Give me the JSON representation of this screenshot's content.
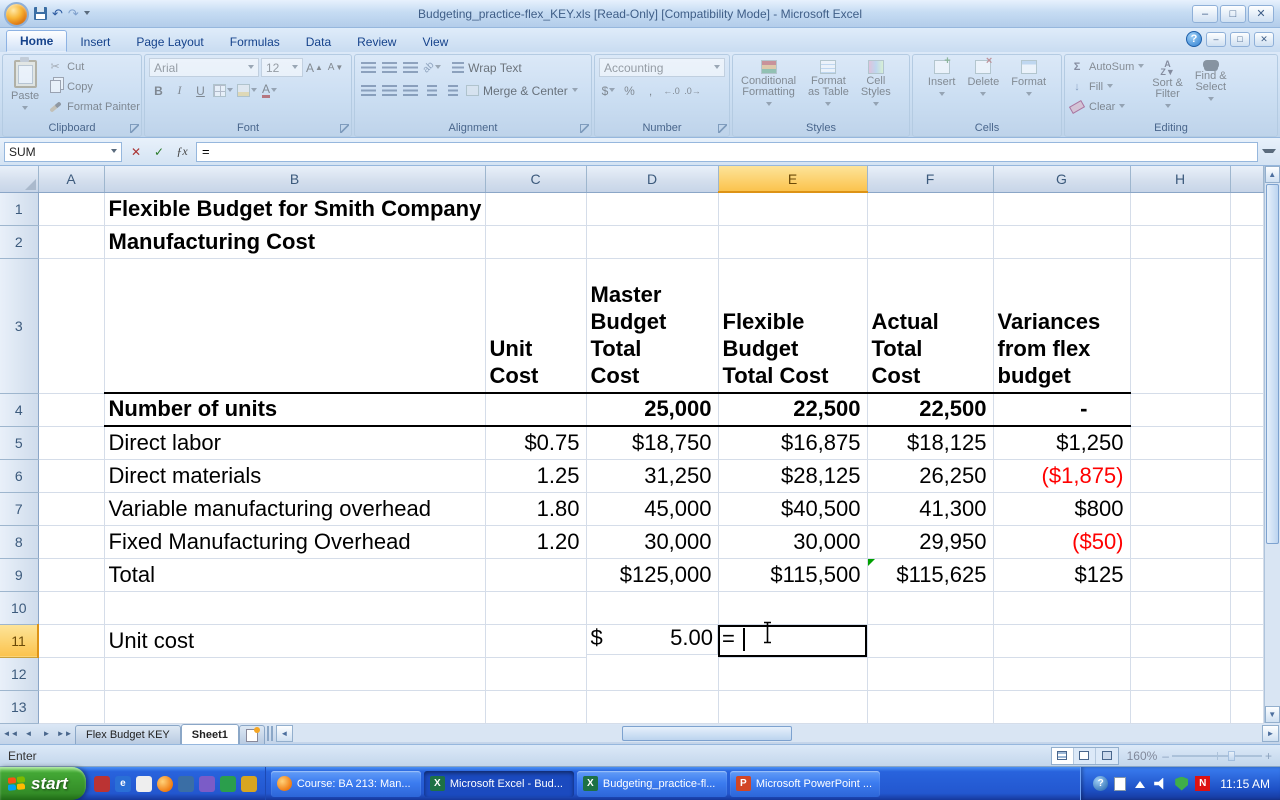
{
  "window": {
    "title": "Budgeting_practice-flex_KEY.xls  [Read-Only]  [Compatibility Mode] - Microsoft Excel"
  },
  "icons": {
    "undo": "↶",
    "redo": "↷",
    "scissors": "✂",
    "cancel": "✕",
    "check": "✓",
    "fx": "ƒx",
    "sigma": "Σ",
    "bold": "B",
    "italic": "I",
    "underline": "U",
    "font_color": "A",
    "grow_font": "A",
    "shrink_font": "A",
    "dollar": "$",
    "percent": "%",
    "comma": ",",
    "inc_decimal": "←.0",
    "dec_decimal": ".0→",
    "help": "?",
    "minimize": "–",
    "maximize": "□",
    "close": "✕",
    "az_sort": "A↓Z",
    "norton_n": "N",
    "question": "?"
  },
  "ribbon": {
    "tabs": [
      "Home",
      "Insert",
      "Page Layout",
      "Formulas",
      "Data",
      "Review",
      "View"
    ],
    "active_tab": "Home",
    "clipboard": {
      "title": "Clipboard",
      "paste": "Paste",
      "cut": "Cut",
      "copy": "Copy",
      "format_painter": "Format Painter"
    },
    "font": {
      "title": "Font",
      "font_name": "Arial",
      "font_size": "12"
    },
    "alignment": {
      "title": "Alignment",
      "wrap_text": "Wrap Text",
      "merge_center": "Merge & Center"
    },
    "number": {
      "title": "Number",
      "format": "Accounting"
    },
    "styles": {
      "title": "Styles",
      "conditional_formatting_1": "Conditional",
      "conditional_formatting_2": "Formatting",
      "format_as_table_1": "Format",
      "format_as_table_2": "as Table",
      "cell_styles_1": "Cell",
      "cell_styles_2": "Styles"
    },
    "cells": {
      "title": "Cells",
      "insert": "Insert",
      "delete": "Delete",
      "format": "Format"
    },
    "editing": {
      "title": "Editing",
      "autosum": "AutoSum",
      "fill": "Fill",
      "clear": "Clear",
      "sort_filter_1": "Sort &",
      "sort_filter_2": "Filter",
      "find_select_1": "Find &",
      "find_select_2": "Select"
    }
  },
  "formula_bar": {
    "name_box": "SUM",
    "formula": "="
  },
  "grid": {
    "columns": [
      "A",
      "B",
      "C",
      "D",
      "E",
      "F",
      "G",
      "H"
    ],
    "rows": [
      "1",
      "2",
      "3",
      "4",
      "5",
      "6",
      "7",
      "8",
      "9",
      "10",
      "11",
      "12",
      "13"
    ],
    "active_cell": "E11",
    "selected_column": "E",
    "selected_row": "11"
  },
  "sheet": {
    "title_line1": "Flexible Budget for Smith Company",
    "title_line2": "Manufacturing Cost",
    "col_headers": {
      "c": [
        "Unit",
        "Cost"
      ],
      "d": [
        "Master",
        "Budget",
        "Total",
        "Cost"
      ],
      "e": [
        "Flexible",
        "Budget",
        "Total Cost"
      ],
      "f": [
        "Actual",
        "Total",
        "Cost"
      ],
      "g": [
        "Variances",
        "from flex",
        "budget"
      ]
    },
    "rows": {
      "r4": {
        "label": "Number of units",
        "d": "25,000",
        "e": "22,500",
        "f": "22,500",
        "g": "-"
      },
      "r5": {
        "label": "Direct labor",
        "c": "$0.75",
        "d": "$18,750",
        "e": "$16,875",
        "f": "$18,125",
        "g": "$1,250"
      },
      "r6": {
        "label": "Direct materials",
        "c": "1.25",
        "d": "31,250",
        "e": "$28,125",
        "f": "26,250",
        "g": "($1,875)"
      },
      "r7": {
        "label": "Variable manufacturing overhead",
        "c": "1.80",
        "d": "45,000",
        "e": "$40,500",
        "f": "41,300",
        "g": "$800"
      },
      "r8": {
        "label": "Fixed Manufacturing Overhead",
        "c": "1.20",
        "d": "30,000",
        "e": "30,000",
        "f": "29,950",
        "g": "($50)"
      },
      "r9": {
        "label": "Total",
        "d": "$125,000",
        "e": "$115,500",
        "f": "$115,625",
        "g": "$125"
      },
      "r11": {
        "label": "Unit cost",
        "d_symbol": "$",
        "d_value": "5.00",
        "edit_value": "="
      }
    }
  },
  "sheet_tabs": {
    "tabs": [
      "Flex Budget KEY",
      "Sheet1"
    ],
    "active": "Sheet1"
  },
  "status_bar": {
    "mode": "Enter",
    "zoom": "160%"
  },
  "taskbar": {
    "start_label": "start",
    "tasks": [
      {
        "label": "Course: BA 213: Man...",
        "active": false
      },
      {
        "label": "Microsoft Excel - Bud...",
        "active": true
      },
      {
        "label": "Budgeting_practice-fl...",
        "active": false
      },
      {
        "label": "Microsoft PowerPoint ...",
        "active": false
      }
    ],
    "clock": "11:15 AM"
  },
  "colors": {
    "negative_value": "#ff0000",
    "selection_header_fill": "#fbc34d",
    "taskbar_blue": "#245edb",
    "start_button_green": "#43a735",
    "grid_line": "#d5dde9"
  }
}
